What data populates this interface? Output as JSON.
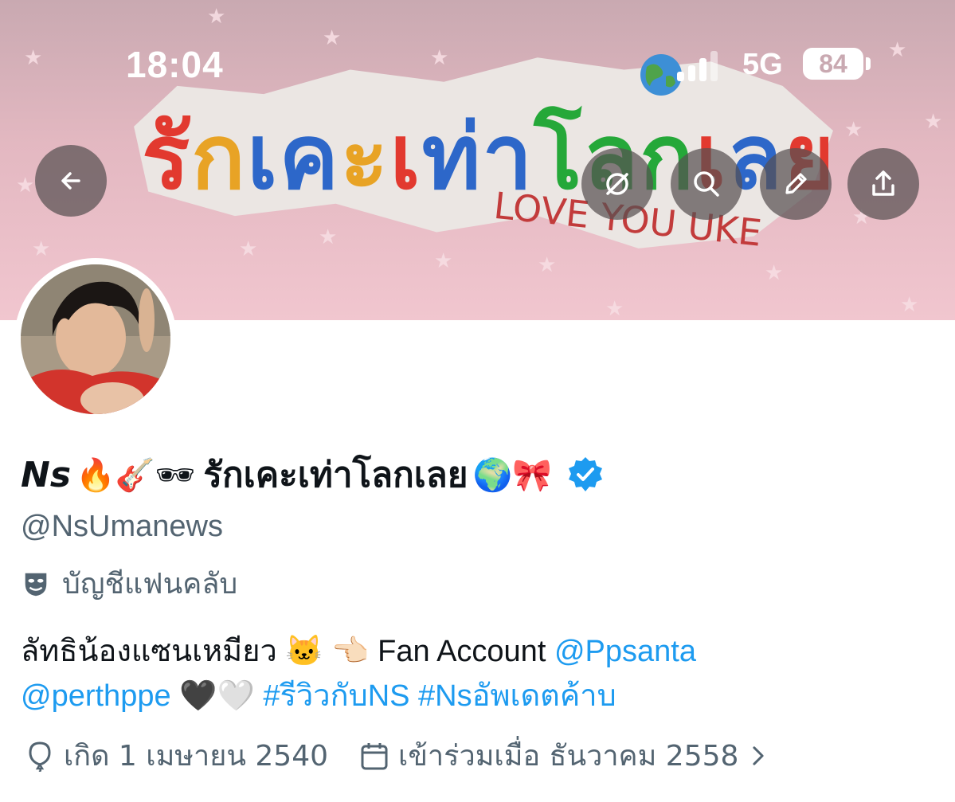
{
  "status_bar": {
    "time": "18:04",
    "network": "5G",
    "battery": "84"
  },
  "banner": {
    "title_thai": "รักเคะเท่าโลกเลย",
    "title_english": "LOVE YOU UKE",
    "background_color": "#e7b9c2"
  },
  "nav": {
    "back_icon": "arrow-left-icon",
    "grok_icon": "grok-icon",
    "search_icon": "search-icon",
    "edit_icon": "pencil-icon",
    "share_icon": "share-icon"
  },
  "profile": {
    "name_latin": "Ns",
    "name_emojis_before": "🔥🎸🕶",
    "name_thai": "รักเคะเท่าโลกเลย",
    "name_emojis_after": "🌍🎀",
    "verified": true,
    "handle": "@NsUmanews",
    "fan_label": "บัญชีแฟนคลับ",
    "fan_icon": "theater-masks-icon"
  },
  "bio": {
    "line1_text": "ลัทธิน้องแซนเหมียว 🐱 👈🏻 Fan Account ",
    "mention1": "@Ppsanta",
    "mention2": "@perthppe",
    "hearts": " 🖤🤍 ",
    "hashtag1": "#รีวิวกับNS",
    "hashtag2": "#Nsอัพเดตค้าบ"
  },
  "meta": {
    "birth": "เกิด 1 เมษายน 2540",
    "joined": "เข้าร่วมเมื่อ ธันวาคม 2558",
    "link_color": "#1d9bf0"
  }
}
